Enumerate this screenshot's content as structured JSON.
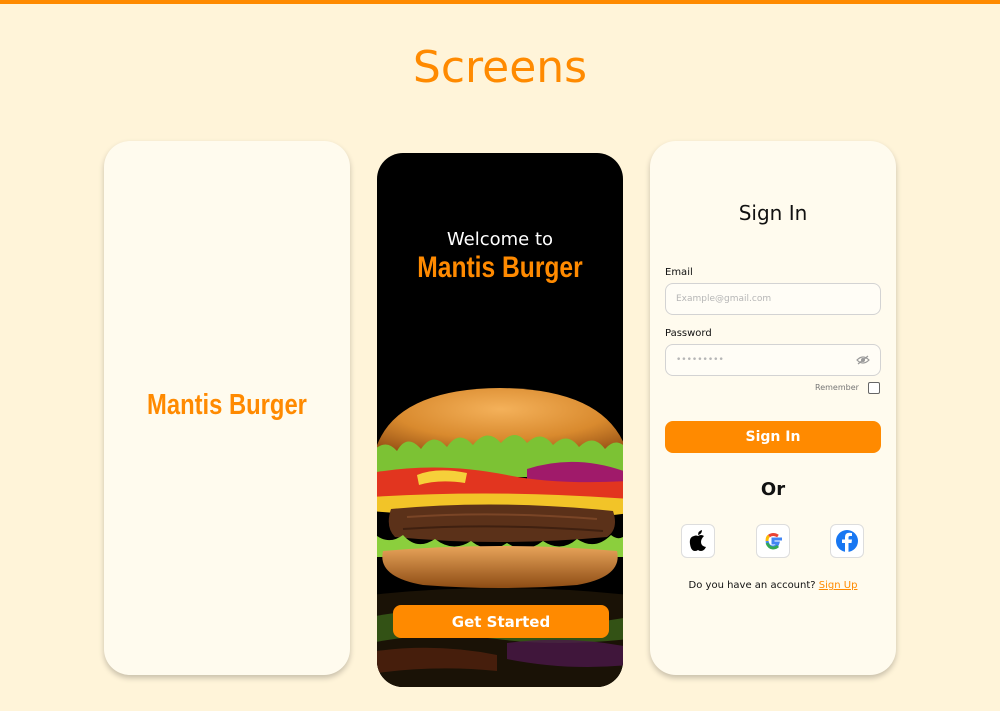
{
  "page": {
    "title": "Screens"
  },
  "splash": {
    "brand": "Mantis Burger"
  },
  "welcome": {
    "greeting": "Welcome to",
    "brand": "Mantis Burger",
    "button_label": "Get Started",
    "image": "burger-photo"
  },
  "signin": {
    "title": "Sign In",
    "email_label": "Email",
    "email_placeholder": "Example@gmail.com",
    "password_label": "Password",
    "password_value": "•••••••••",
    "remember_label": "Remember",
    "remember_checked": false,
    "button_label": "Sign In",
    "or_text": "Or",
    "social": [
      "apple-icon",
      "google-icon",
      "facebook-icon"
    ],
    "account_prompt": "Do you have an account?",
    "signup_label": "Sign Up"
  },
  "colors": {
    "accent": "#ff8a00",
    "background": "#fff4d9",
    "card": "#fffbee"
  }
}
